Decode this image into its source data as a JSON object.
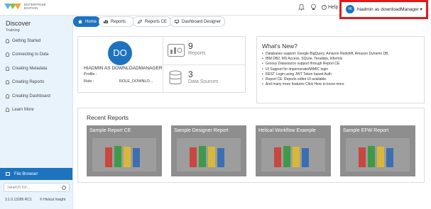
{
  "header": {
    "logo_line1": "ENTERPRISE",
    "logo_line2": "EDITION",
    "help_label": "Help",
    "user_initials": "HI",
    "user_name": "hiadmin as downloadManager"
  },
  "sidebar": {
    "title": "Discover",
    "subtitle": "Training",
    "items": [
      {
        "label": "Getting Started"
      },
      {
        "label": "Connecting to Data"
      },
      {
        "label": "Creating Metadata"
      },
      {
        "label": "Creating Reports"
      },
      {
        "label": "Creating Dashboard"
      },
      {
        "label": "Learn More"
      }
    ],
    "file_browser": "File Browser",
    "search_placeholder": "Search for...",
    "version": "3.1.0.13285 RC1",
    "brand": "© Helical Insight"
  },
  "tabs": [
    {
      "label": "Home",
      "active": true
    },
    {
      "label": "Reports",
      "active": false
    },
    {
      "label": "Reports CE",
      "active": false
    },
    {
      "label": "Dashboard Designer",
      "active": false
    }
  ],
  "profile": {
    "initials": "DO",
    "name": "HIADMIN AS DOWNLOADMANAGER",
    "profile_label": "Profile :",
    "role_label": "Role :",
    "role_value": "ROLE_DOWNLO...",
    "reports_count": "9",
    "reports_label": "Reports",
    "datasources_count": "3",
    "datasources_label": "Data Sources"
  },
  "whats_new": {
    "title": "What's New?",
    "items": [
      "Databases support: Google BigQuery, Amazon Redshift, Amazon Dynamo DB,",
      "IBM DB2, MS Access, SQLite, Teradata, Informix",
      "Groovy Datasource support through Report CE",
      "UI Support for impersonate/MIMIC login",
      "REST Login using JWT Token based Auth",
      "Report CE: Reports editor UI available.",
      "And many more features Click Here to know more"
    ]
  },
  "recent_reports": {
    "title": "Recent Reports",
    "items": [
      {
        "title": "Sample Report CE"
      },
      {
        "title": "Sample Designer Report"
      },
      {
        "title": "Helical Workflow Example"
      },
      {
        "title": "Sample EFW Report"
      }
    ]
  },
  "colors": {
    "accent": "#1e73be",
    "highlight": "#e01b1b",
    "sidebar_bg": "#e8f3fc"
  }
}
